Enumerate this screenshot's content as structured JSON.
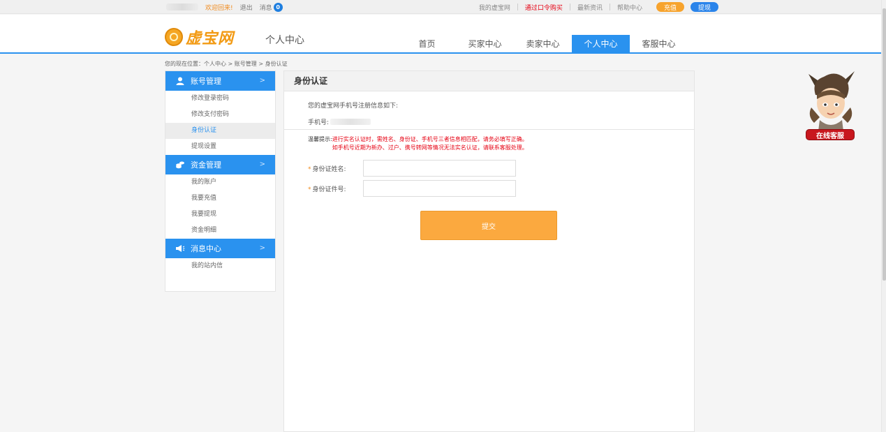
{
  "topbar": {
    "welcome": "欢迎回来!",
    "logout": "退出",
    "message": "消息",
    "message_count": "0",
    "links": [
      "我的虚宝网",
      "通过口令购买",
      "最新资讯",
      "帮助中心"
    ],
    "recharge": "充值",
    "withdraw": "提现"
  },
  "header": {
    "logo": "虚宝网",
    "title": "个人中心",
    "nav": [
      "首页",
      "买家中心",
      "卖家中心",
      "个人中心",
      "客服中心"
    ],
    "active_nav": "个人中心"
  },
  "breadcrumb": "您的现在位置：个人中心 > 账号管理 > 身份认证",
  "sidebar": {
    "groups": [
      {
        "title": "账号管理",
        "icon": "user-icon",
        "items": [
          "修改登录密码",
          "修改支付密码",
          "身份认证",
          "提现设置"
        ]
      },
      {
        "title": "资金管理",
        "icon": "coins-icon",
        "items": [
          "我的账户",
          "我要充值",
          "我要提现",
          "资金明细"
        ]
      },
      {
        "title": "消息中心",
        "icon": "megaphone-icon",
        "items": [
          "我的站内信"
        ]
      }
    ],
    "active_item": "身份认证"
  },
  "main": {
    "title": "身份认证",
    "info_line": "您的虚宝网手机号注册信息如下:",
    "phone_label": "手机号:",
    "tip_label": "温馨提示:",
    "tip_line1": "进行实名认证时，需姓名、身份证、手机号三者信息相匹配，请务必填写正确。",
    "tip_line2": "如手机号近期为新办、过户、携号转网等情况无法实名认证，请联系客服处理。",
    "name_label": "身份证姓名:",
    "id_label": "身份证件号:",
    "name_value": "",
    "id_value": "",
    "submit": "提交"
  },
  "cs": {
    "label": "在线客服"
  },
  "colors": {
    "brand_blue": "#2a92ef",
    "orange": "#fba93f",
    "red": "#e60012",
    "badge_red": "#c8171e"
  }
}
